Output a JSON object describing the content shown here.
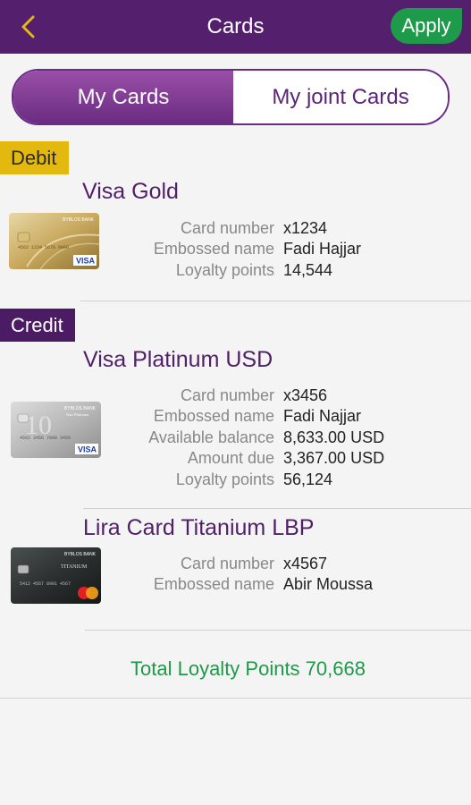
{
  "header": {
    "title": "Cards",
    "apply_label": "Apply"
  },
  "tabs": {
    "my_cards": "My Cards",
    "joint_cards": "My joint Cards"
  },
  "sections": {
    "debit": {
      "label": "Debit",
      "cards": [
        {
          "name": "Visa Gold",
          "image": "visa-gold-card",
          "fields": [
            {
              "label": "Card number",
              "value": "x1234"
            },
            {
              "label": "Embossed name",
              "value": "Fadi Hajjar"
            },
            {
              "label": "Loyalty points",
              "value": "14,544"
            }
          ]
        }
      ]
    },
    "credit": {
      "label": "Credit",
      "cards": [
        {
          "name": "Visa Platinum USD",
          "image": "visa-platinum-card",
          "fields": [
            {
              "label": "Card number",
              "value": "x3456"
            },
            {
              "label": "Embossed name",
              "value": "Fadi Najjar"
            },
            {
              "label": "Available balance",
              "value": "8,633.00 USD"
            },
            {
              "label": "Amount due",
              "value": "3,367.00 USD"
            },
            {
              "label": "Loyalty points",
              "value": "56,124"
            }
          ]
        },
        {
          "name": "Lira Card Titanium LBP",
          "image": "lira-titanium-card",
          "fields": [
            {
              "label": "Card number",
              "value": "x4567"
            },
            {
              "label": "Embossed name",
              "value": "Abir Moussa"
            }
          ]
        }
      ]
    }
  },
  "total": "Total Loyalty Points 70,668",
  "colors": {
    "header": "#54206e",
    "apply": "#1e9b4a",
    "debit_tag": "#e3b90f",
    "credit_tag": "#4b1c63",
    "card_name": "#4f1f68",
    "total": "#1c9a48"
  }
}
